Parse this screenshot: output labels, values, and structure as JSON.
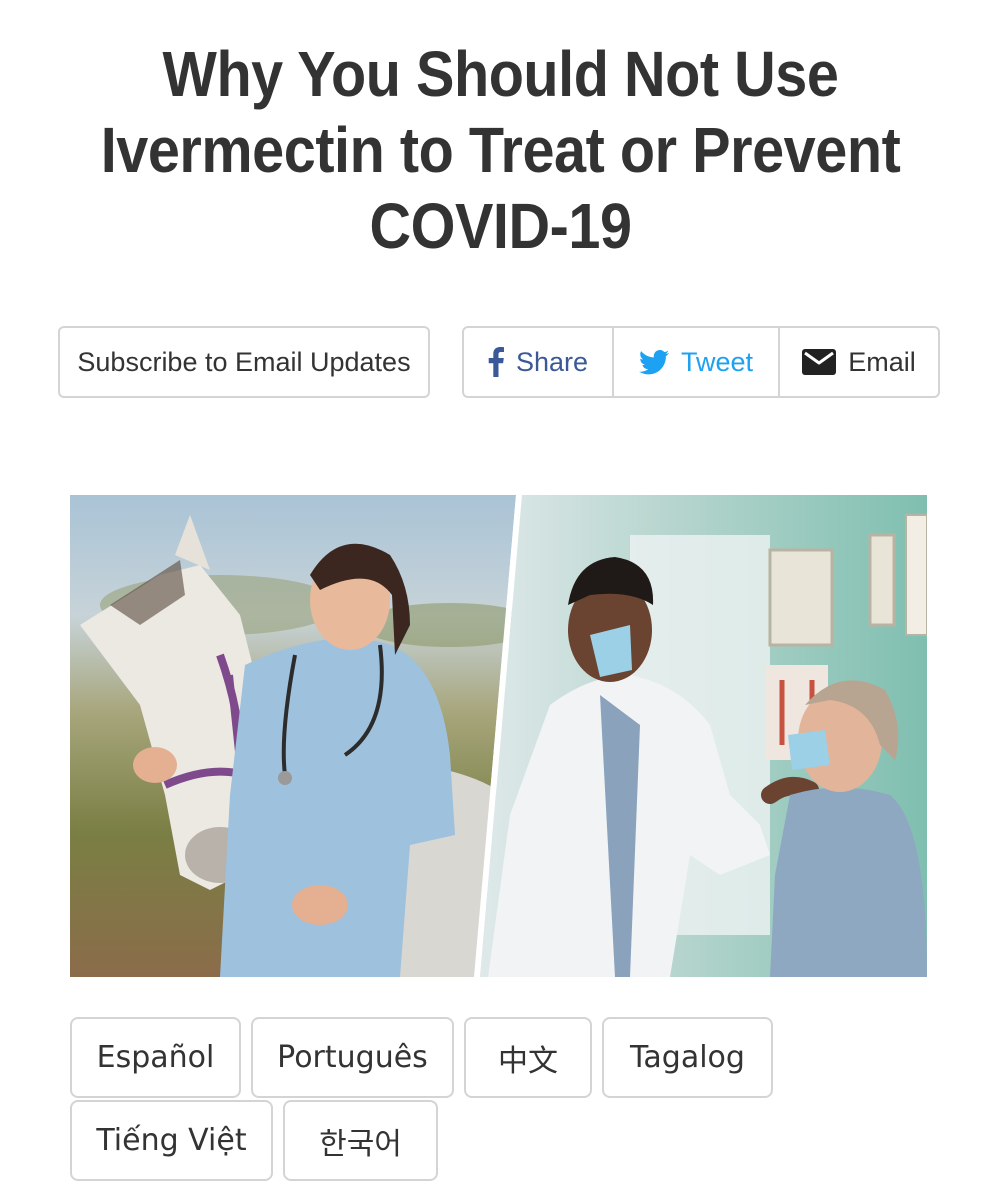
{
  "page": {
    "title_line1": "Why You Should Not Use",
    "title_line2": "Ivermectin to Treat or Prevent",
    "title_line3": "COVID-19"
  },
  "actions": {
    "subscribe_label": "Subscribe to Email Updates",
    "share_label": "Share",
    "tweet_label": "Tweet",
    "email_label": "Email"
  },
  "icons": {
    "share": "facebook-icon",
    "tweet": "twitter-icon",
    "email": "envelope-icon"
  },
  "colors": {
    "facebook": "#3b5998",
    "twitter": "#1da1f2",
    "text": "#333333",
    "border": "#d4d4d4"
  },
  "languages": [
    "Español",
    "Português",
    "中文",
    "Tagalog",
    "Tiếng Việt",
    "한국어"
  ]
}
